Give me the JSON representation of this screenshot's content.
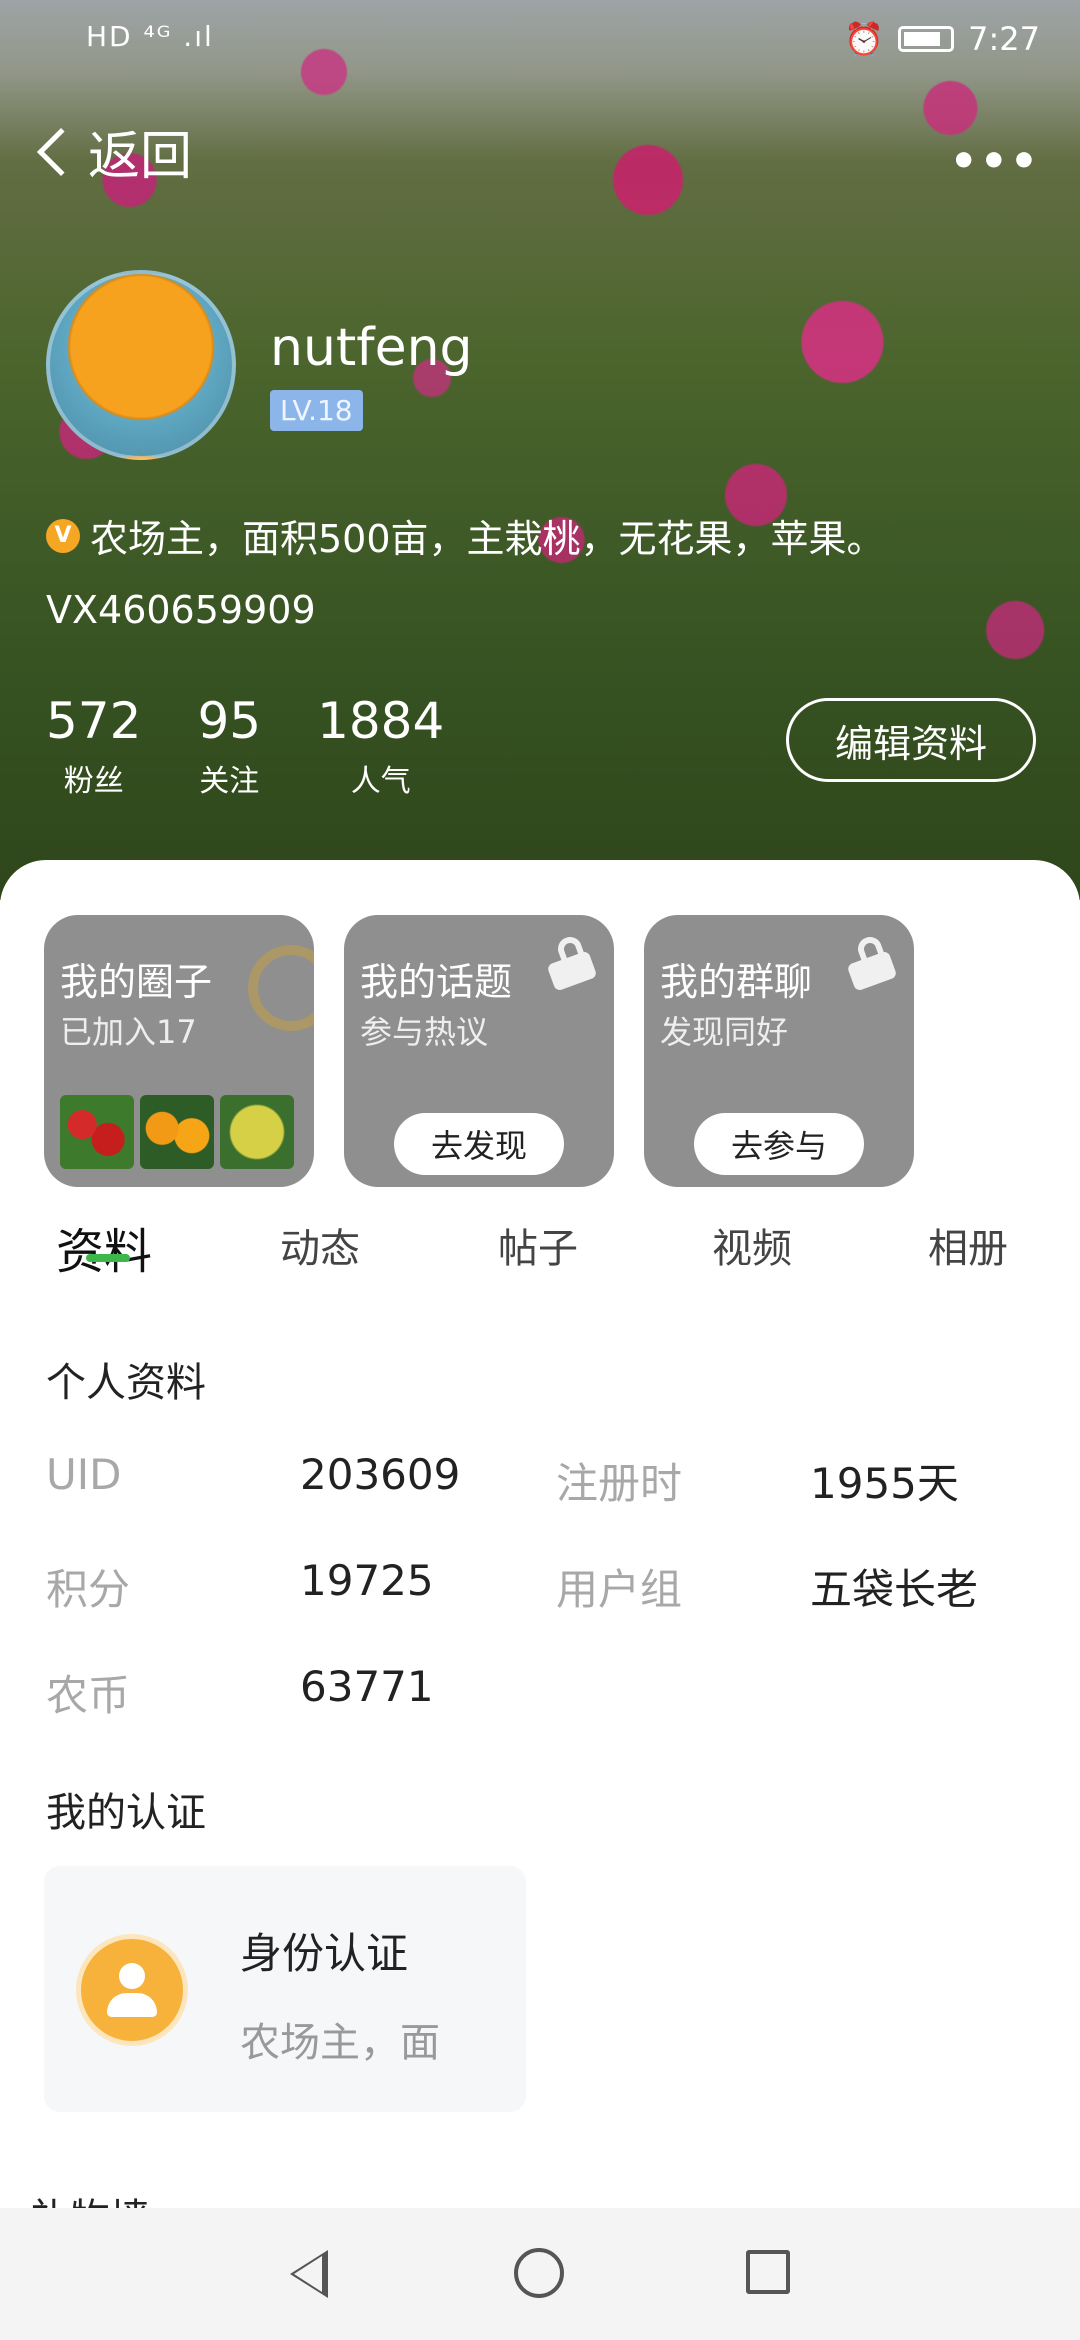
{
  "status_bar": {
    "left": "HD ⁴ᴳ .ıl",
    "time": "7:27"
  },
  "topbar": {
    "back_label": "返回",
    "more_label": "•••"
  },
  "profile": {
    "username": "nutfeng",
    "level": "LV.18",
    "bio": "农场主，面积500亩，主栽桃，无花果，苹果。",
    "verify_badge": "V",
    "vx": "ⅤX460659909",
    "stats": [
      {
        "num": "572",
        "label": "粉丝"
      },
      {
        "num": "95",
        "label": "关注"
      },
      {
        "num": "1884",
        "label": "人气"
      }
    ],
    "edit_label": "编辑资料"
  },
  "cards": [
    {
      "title": "我的圈子",
      "sub": "已加入17"
    },
    {
      "title": "我的话题",
      "sub": "参与热议",
      "action": "去发现"
    },
    {
      "title": "我的群聊",
      "sub": "发现同好",
      "action": "去参与"
    }
  ],
  "tabs": [
    "资料",
    "动态",
    "帖子",
    "视频",
    "相册"
  ],
  "personal": {
    "title": "个人资料",
    "rows": [
      {
        "l1": "UID",
        "v1": "203609",
        "l2": "注册时",
        "v2": "1955天"
      },
      {
        "l1": "积分",
        "v1": "19725",
        "l2": "用户组",
        "v2": "五袋长老"
      },
      {
        "l1": "农币",
        "v1": "63771"
      }
    ]
  },
  "certification": {
    "title": "我的认证",
    "card_title": "身份认证",
    "card_desc": "农场主，面"
  },
  "gift_wall": "礼物墙",
  "colors": {
    "accent": "#3cb84a",
    "level_badge": "#8cb6ea",
    "verify": "#f5a623"
  }
}
